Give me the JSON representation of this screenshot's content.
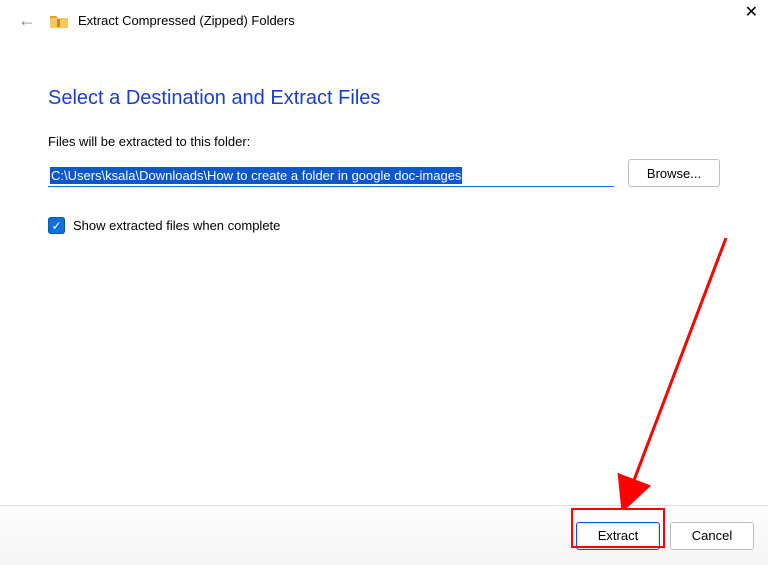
{
  "titlebar": {
    "title": "Extract Compressed (Zipped) Folders"
  },
  "heading": "Select a Destination and Extract Files",
  "subheading": "Files will be extracted to this folder:",
  "path": {
    "value": "C:\\Users\\ksala\\Downloads\\How to create a folder in google doc-images"
  },
  "buttons": {
    "browse": "Browse...",
    "extract": "Extract",
    "cancel": "Cancel"
  },
  "checkbox": {
    "label": "Show extracted files when complete",
    "checked": true
  }
}
